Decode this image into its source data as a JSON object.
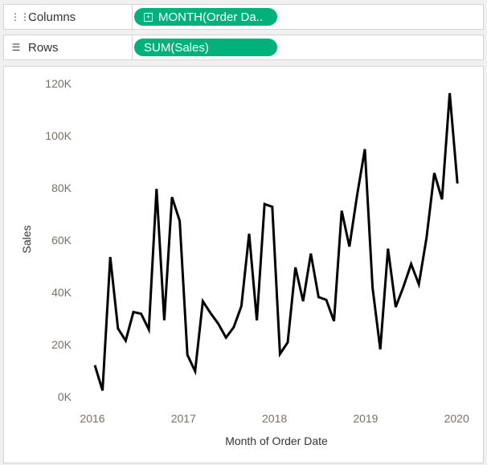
{
  "shelves": {
    "columns_label": "Columns",
    "columns_icon": "columns-icon",
    "columns_pill": "MONTH(Order Da..",
    "rows_label": "Rows",
    "rows_icon": "rows-icon",
    "rows_pill": "SUM(Sales)",
    "pill_color": "#00b17c"
  },
  "chart_data": {
    "type": "line",
    "title": "",
    "xlabel": "Month of Order Date",
    "ylabel": "Sales",
    "ylim": [
      0,
      120000
    ],
    "y_ticks": [
      0,
      20000,
      40000,
      60000,
      80000,
      100000,
      120000
    ],
    "y_tick_labels": [
      "0K",
      "20K",
      "40K",
      "60K",
      "80K",
      "100K",
      "120K"
    ],
    "x_tick_labels": [
      "2016",
      "2017",
      "2018",
      "2019",
      "2020"
    ],
    "grid": false,
    "series": [
      {
        "name": "SUM(Sales)",
        "color": "#000000",
        "values": [
          14237,
          4520,
          55691,
          28295,
          23648,
          34595,
          33946,
          27909,
          81777,
          31453,
          78629,
          69546,
          18174,
          11951,
          38726,
          34195,
          30132,
          24797,
          28765,
          36898,
          64595,
          31405,
          75973,
          74920,
          18542,
          22979,
          51716,
          38750,
          56988,
          40345,
          39262,
          31115,
          73410,
          59688,
          79412,
          96999,
          43971,
          20301,
          58872,
          36522,
          44261,
          52982,
          45264,
          63121,
          87867,
          77777,
          118448,
          83829
        ]
      }
    ]
  }
}
